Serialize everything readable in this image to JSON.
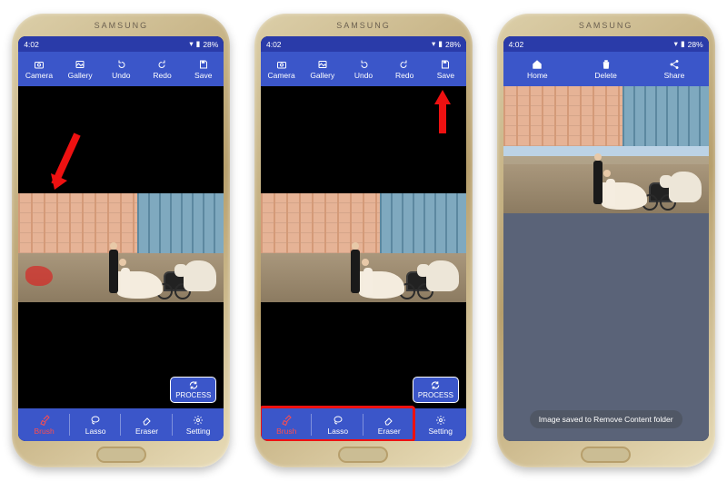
{
  "device": {
    "brand": "SAMSUNG"
  },
  "status": {
    "time": "4:02",
    "battery": "28%"
  },
  "colors": {
    "toolbar": "#3b56c9",
    "statusbar": "#2a3ba9",
    "accent_red": "#e11",
    "active_red": "#ff4d4d"
  },
  "toolbar_edit": {
    "items": [
      {
        "id": "camera",
        "label": "Camera",
        "icon": "camera-icon"
      },
      {
        "id": "gallery",
        "label": "Gallery",
        "icon": "gallery-icon"
      },
      {
        "id": "undo",
        "label": "Undo",
        "icon": "undo-icon"
      },
      {
        "id": "redo",
        "label": "Redo",
        "icon": "redo-icon"
      },
      {
        "id": "save",
        "label": "Save",
        "icon": "save-icon"
      }
    ]
  },
  "toolbar_result": {
    "items": [
      {
        "id": "home",
        "label": "Home",
        "icon": "home-icon"
      },
      {
        "id": "delete",
        "label": "Delete",
        "icon": "delete-icon"
      },
      {
        "id": "share",
        "label": "Share",
        "icon": "share-icon"
      }
    ]
  },
  "process_button": {
    "label": "PROCESS",
    "icon": "refresh-icon"
  },
  "bottombar": {
    "items": [
      {
        "id": "brush",
        "label": "Brush",
        "icon": "brush-icon"
      },
      {
        "id": "lasso",
        "label": "Lasso",
        "icon": "lasso-icon"
      },
      {
        "id": "eraser",
        "label": "Eraser",
        "icon": "eraser-icon"
      },
      {
        "id": "setting",
        "label": "Setting",
        "icon": "gear-icon"
      }
    ],
    "active": "brush"
  },
  "toast": {
    "text": "Image saved to Remove Content folder"
  },
  "screens": [
    {
      "id": "step1",
      "layout": "editor",
      "has_red_mark": true,
      "arrow": {
        "type": "diag-down-left",
        "target": "red-mark"
      }
    },
    {
      "id": "step2",
      "layout": "editor",
      "has_red_mark": false,
      "arrow": {
        "type": "up",
        "target": "save"
      },
      "highlight_tools": [
        "brush",
        "lasso",
        "eraser"
      ]
    },
    {
      "id": "step3",
      "layout": "result",
      "show_toast": true
    }
  ]
}
